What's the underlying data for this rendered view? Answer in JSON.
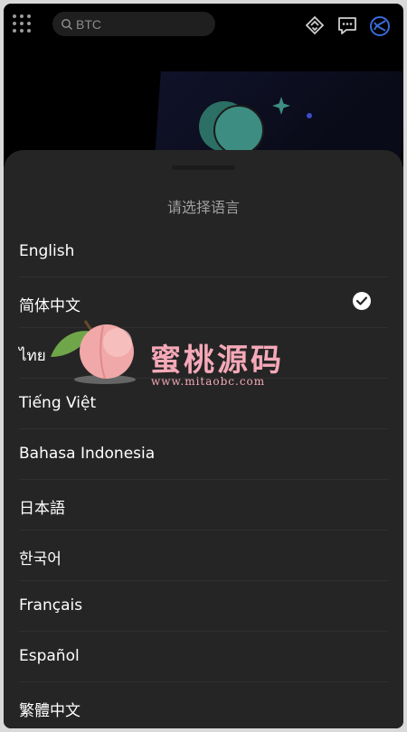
{
  "search": {
    "placeholder": "BTC"
  },
  "icons": {
    "menu": "grid-icon",
    "search": "search-icon",
    "top_right": [
      "diamond-swap-icon",
      "message-icon",
      "network-globe-icon"
    ]
  },
  "sheet": {
    "title": "请选择语言",
    "languages": [
      {
        "label": "English",
        "selected": false
      },
      {
        "label": "简体中文",
        "selected": true
      },
      {
        "label": "ไทย",
        "selected": false
      },
      {
        "label": "Tiếng Việt",
        "selected": false
      },
      {
        "label": "Bahasa Indonesia",
        "selected": false
      },
      {
        "label": "日本語",
        "selected": false
      },
      {
        "label": "한국어",
        "selected": false
      },
      {
        "label": "Français",
        "selected": false
      },
      {
        "label": "Español",
        "selected": false
      },
      {
        "label": "繁體中文",
        "selected": false
      }
    ]
  },
  "watermark": {
    "brand": "蜜桃源码",
    "url": "www.mitaobc.com"
  },
  "colors": {
    "sheet_bg": "#252525",
    "accent_blue": "#3a6bd8",
    "coin": "#3e8d82"
  }
}
